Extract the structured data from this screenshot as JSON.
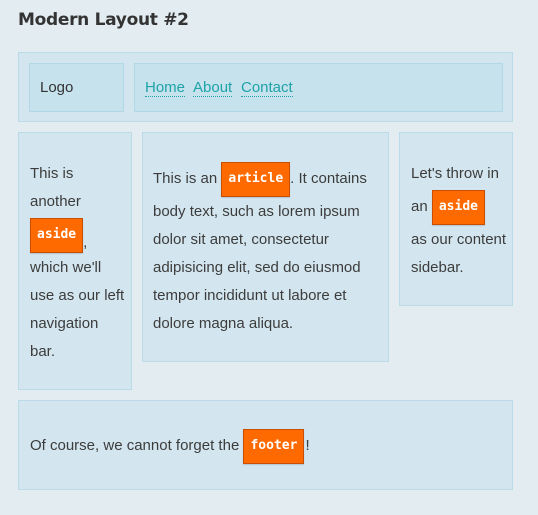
{
  "page": {
    "title": "Modern Layout #2"
  },
  "header": {
    "logo": "Logo",
    "nav": [
      {
        "label": "Home"
      },
      {
        "label": "About"
      },
      {
        "label": "Contact"
      }
    ]
  },
  "left_aside": {
    "line1": "This is",
    "line2": "another",
    "tag": "aside",
    "after_tag": ",",
    "line4": "which we'll",
    "line5": "use as our left",
    "line6": "navigation",
    "line7": "bar."
  },
  "article": {
    "prefix": "This is an",
    "tag": "article",
    "suffix": ". It contains",
    "line2": "body text, such as lorem ipsum",
    "line3": "dolor sit amet, consectetur",
    "line4": "adipisicing elit, sed do eiusmod",
    "line5": "tempor incididunt ut labore et",
    "line6": "dolore magna aliqua."
  },
  "right_aside": {
    "line1": "Let's throw in",
    "prefix": "an",
    "tag": "aside",
    "line3": "as our content",
    "line4": "sidebar."
  },
  "footer": {
    "prefix": "Of course, we cannot forget the",
    "tag": "footer",
    "suffix": "!"
  }
}
